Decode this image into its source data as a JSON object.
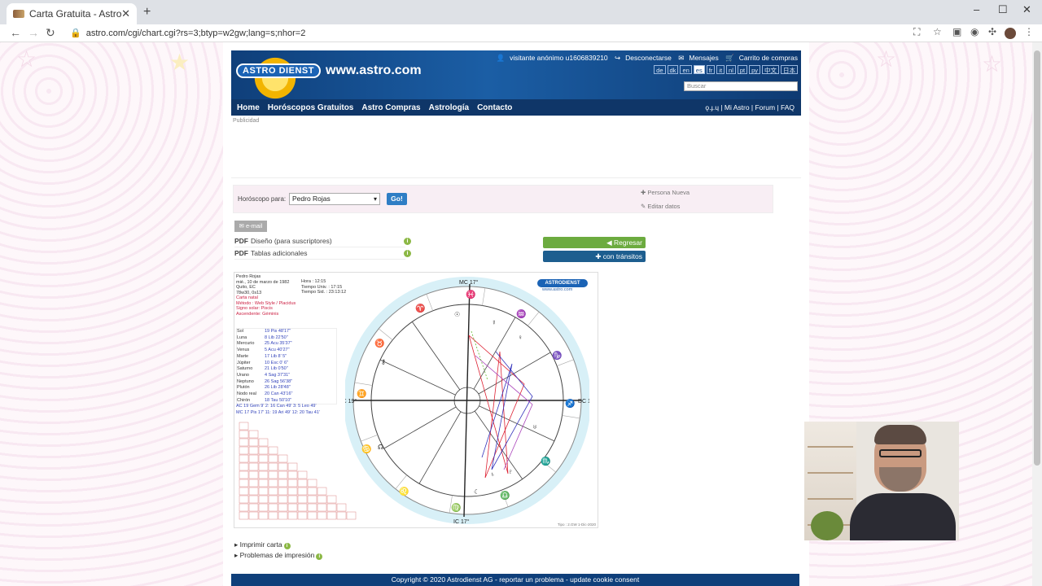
{
  "browser": {
    "tab_title": "Carta Gratuita - Astrodienst",
    "tab_close": "✕",
    "new_tab": "+",
    "url": "astro.com/cgi/chart.cgi?rs=3;btyp=w2gw;lang=s;nhor=2"
  },
  "header": {
    "logo_text": "ASTRO DIENST",
    "site_name": "www.astro.com",
    "user": "visitante anónimo u1606839210",
    "logout": "Desconectarse",
    "messages": "Mensajes",
    "cart": "Carrito de compras",
    "languages": [
      "de",
      "dk",
      "en",
      "es",
      "fr",
      "it",
      "nl",
      "pt",
      "ру",
      "中文",
      "日本"
    ],
    "active_language": "es",
    "search_placeholder": "Buscar",
    "nav": [
      "Home",
      "Horóscopos Gratuitos",
      "Astro Compras",
      "Astrología",
      "Contacto"
    ],
    "nav_right": "ǫ.ɟ.ɥ | Mi Astro | Forum | FAQ"
  },
  "ad_label": "Publicidad",
  "selector": {
    "label": "Horóscopo para:",
    "person": "Pedro Rojas",
    "go": "Go!",
    "new_person": "Persona Nueva",
    "edit_data": "Editar datos"
  },
  "actions": {
    "email": "e-mail",
    "pdf_label": "PDF",
    "pdf1": "Diseño (para suscriptores)",
    "pdf2": "Tablas adicionales",
    "back": "Regresar",
    "transits": "con tránsitos"
  },
  "chart": {
    "name": "Pedro Rojas",
    "date": "mié., 10 de marzo de 1982",
    "place": "Quito, EC",
    "coords": "78w30, 0s13",
    "hour_label": "Hora :",
    "hour": "12:15",
    "ut_label": "Tiempo Univ. :",
    "ut": "17:15",
    "sid_label": "Tiempo Sid. :",
    "sid": "23:13:12",
    "type": "Carta natal",
    "method": "Método : Web Style / Placidus",
    "sun_sign": "Signo solar: Piscis",
    "ascendant": "Ascendente: Géminis",
    "planets": [
      {
        "name": "Sol",
        "pos": "19 Pis 48'17\""
      },
      {
        "name": "Luna",
        "pos": "8 Lib 22'50\""
      },
      {
        "name": "Mercurio",
        "pos": "25 Acu 35'37\""
      },
      {
        "name": "Venus",
        "pos": "5 Acu 40'27\""
      },
      {
        "name": "Marte",
        "pos": "17 Lib 8' 5\""
      },
      {
        "name": "Júpiter",
        "pos": "10 Esc 0' 6\""
      },
      {
        "name": "Saturno",
        "pos": "21 Lib 0'50\""
      },
      {
        "name": "Urano",
        "pos": "4 Sag 37'31\""
      },
      {
        "name": "Neptuno",
        "pos": "26 Sag 56'38\""
      },
      {
        "name": "Plutón",
        "pos": "26 Lib 28'48\""
      },
      {
        "name": "Nodo real",
        "pos": "20 Can 43'16\""
      },
      {
        "name": "Chirón",
        "pos": "18 Tau 50'10\""
      }
    ],
    "houses1": "AC 19 Gem 9'  2: 16 Can 49'  3: 5 Leo 49'",
    "houses2": "MC 17 Pis 17' 11: 19 Ari 49' 12: 20 Tau 41'",
    "mc": "MC 17°",
    "ic": "IC 17°",
    "ac": "AC 19°",
    "dc": "DC 19°",
    "logo": "ASTRODIENST",
    "logo_url": "www.astro.com",
    "tipo": "Tipo : 2.GW  1-Dic-2020"
  },
  "links": {
    "print": "Imprimir carta",
    "problems": "Problemas de impresión"
  },
  "footer": "Copyright © 2020 Astrodienst AG - reportar un problema - update cookie consent"
}
